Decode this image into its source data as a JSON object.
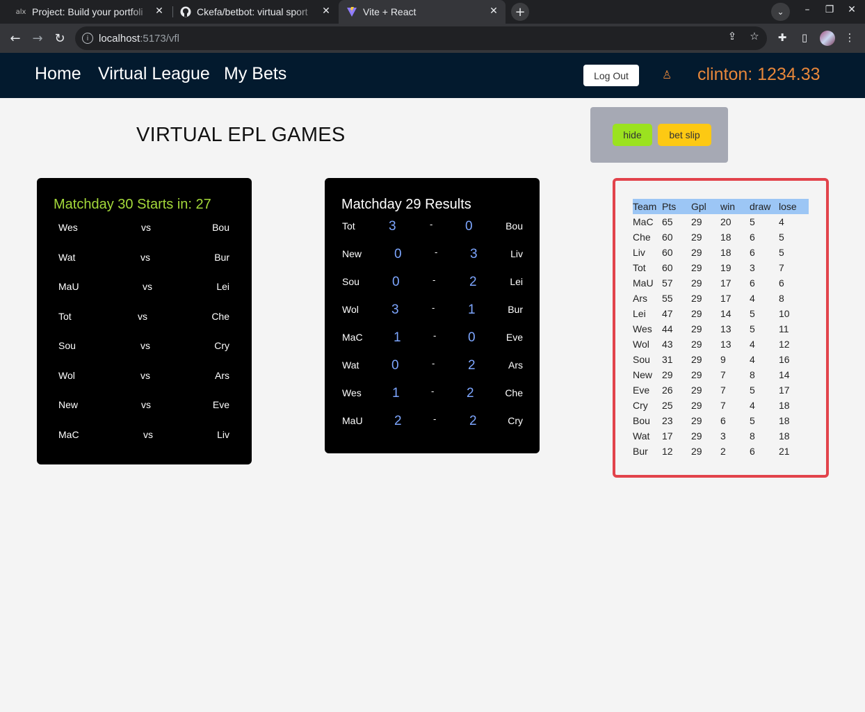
{
  "browser": {
    "tabs": [
      {
        "title": "Project: Build your portfoli",
        "favicon": "alx-favicon"
      },
      {
        "title": "Ckefa/betbot: virtual sport",
        "favicon": "github-favicon"
      },
      {
        "title": "Vite + React",
        "favicon": "vite-favicon"
      }
    ],
    "url_host": "localhost",
    "url_path": ":5173/vfl"
  },
  "nav": {
    "links": [
      "Home",
      "Virtual League",
      "My Bets"
    ],
    "logout_label": "Log Out",
    "balance": "clinton: 1234.33"
  },
  "page": {
    "title": "VIRTUAL EPL GAMES",
    "hide_label": "hide",
    "betslip_label": "bet slip"
  },
  "upcoming": {
    "title": "Matchday 30 Starts in: 27",
    "fixtures": [
      {
        "home": "Wes",
        "vs": "vs",
        "away": "Bou"
      },
      {
        "home": "Wat",
        "vs": "vs",
        "away": "Bur"
      },
      {
        "home": "MaU",
        "vs": "vs",
        "away": "Lei"
      },
      {
        "home": "Tot",
        "vs": "vs",
        "away": "Che"
      },
      {
        "home": "Sou",
        "vs": "vs",
        "away": "Cry"
      },
      {
        "home": "Wol",
        "vs": "vs",
        "away": "Ars"
      },
      {
        "home": "New",
        "vs": "vs",
        "away": "Eve"
      },
      {
        "home": "MaC",
        "vs": "vs",
        "away": "Liv"
      }
    ]
  },
  "results": {
    "title": "Matchday 29 Results",
    "games": [
      {
        "home": "Tot",
        "hs": "3",
        "dash": "-",
        "as": "0",
        "away": "Bou"
      },
      {
        "home": "New",
        "hs": "0",
        "dash": "-",
        "as": "3",
        "away": "Liv"
      },
      {
        "home": "Sou",
        "hs": "0",
        "dash": "-",
        "as": "2",
        "away": "Lei"
      },
      {
        "home": "Wol",
        "hs": "3",
        "dash": "-",
        "as": "1",
        "away": "Bur"
      },
      {
        "home": "MaC",
        "hs": "1",
        "dash": "-",
        "as": "0",
        "away": "Eve"
      },
      {
        "home": "Wat",
        "hs": "0",
        "dash": "-",
        "as": "2",
        "away": "Ars"
      },
      {
        "home": "Wes",
        "hs": "1",
        "dash": "-",
        "as": "2",
        "away": "Che"
      },
      {
        "home": "MaU",
        "hs": "2",
        "dash": "-",
        "as": "2",
        "away": "Cry"
      }
    ]
  },
  "standings": {
    "headers": [
      "Team",
      "Pts",
      "Gpl",
      "win",
      "draw",
      "lose"
    ],
    "rows": [
      [
        "MaC",
        "65",
        "29",
        "20",
        "5",
        "4"
      ],
      [
        "Che",
        "60",
        "29",
        "18",
        "6",
        "5"
      ],
      [
        "Liv",
        "60",
        "29",
        "18",
        "6",
        "5"
      ],
      [
        "Tot",
        "60",
        "29",
        "19",
        "3",
        "7"
      ],
      [
        "MaU",
        "57",
        "29",
        "17",
        "6",
        "6"
      ],
      [
        "Ars",
        "55",
        "29",
        "17",
        "4",
        "8"
      ],
      [
        "Lei",
        "47",
        "29",
        "14",
        "5",
        "10"
      ],
      [
        "Wes",
        "44",
        "29",
        "13",
        "5",
        "11"
      ],
      [
        "Wol",
        "43",
        "29",
        "13",
        "4",
        "12"
      ],
      [
        "Sou",
        "31",
        "29",
        "9",
        "4",
        "16"
      ],
      [
        "New",
        "29",
        "29",
        "7",
        "8",
        "14"
      ],
      [
        "Eve",
        "26",
        "29",
        "7",
        "5",
        "17"
      ],
      [
        "Cry",
        "25",
        "29",
        "7",
        "4",
        "18"
      ],
      [
        "Bou",
        "23",
        "29",
        "6",
        "5",
        "18"
      ],
      [
        "Wat",
        "17",
        "29",
        "3",
        "8",
        "18"
      ],
      [
        "Bur",
        "12",
        "29",
        "2",
        "6",
        "21"
      ]
    ]
  },
  "colors": {
    "nav_bg": "#031a2e",
    "balance": "#e8873a",
    "countdown": "#a4d93a",
    "score": "#7da6ff",
    "hide_btn": "#9be21f",
    "betslip_btn": "#fdc913",
    "table_border": "#e2434b",
    "table_header": "#9cc6f5"
  }
}
